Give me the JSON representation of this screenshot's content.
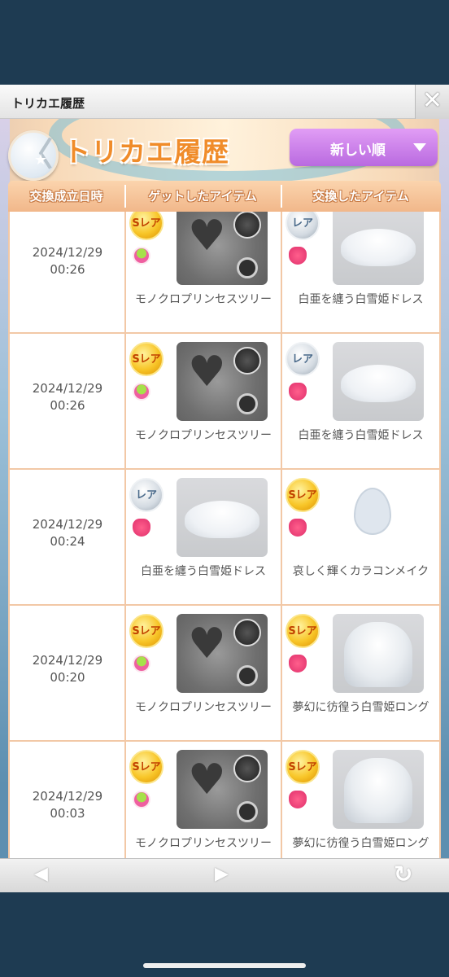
{
  "window": {
    "title": "トリカエ履歴",
    "close_glyph": "✕"
  },
  "header": {
    "back_glyph": "〈",
    "title": "トリカエ履歴",
    "sort_label": "新しい順"
  },
  "table": {
    "columns": [
      "交換成立日時",
      "ゲットしたアイテム",
      "交換したアイテム"
    ],
    "rows": [
      {
        "date": "2024/12/29",
        "time": "00:26",
        "get": {
          "rarity": "Sレア",
          "category": "face",
          "image": "heart-mirror",
          "name": "モノクロプリンセスツリー"
        },
        "gave": {
          "rarity": "レア",
          "category": "dress",
          "image": "white-dress",
          "name": "白亜を纏う白雪姫ドレス"
        }
      },
      {
        "date": "2024/12/29",
        "time": "00:26",
        "get": {
          "rarity": "Sレア",
          "category": "face",
          "image": "heart-mirror",
          "name": "モノクロプリンセスツリー"
        },
        "gave": {
          "rarity": "レア",
          "category": "dress",
          "image": "white-dress",
          "name": "白亜を纏う白雪姫ドレス"
        }
      },
      {
        "date": "2024/12/29",
        "time": "00:24",
        "get": {
          "rarity": "レア",
          "category": "dress",
          "image": "white-dress",
          "name": "白亜を纏う白雪姫ドレス"
        },
        "gave": {
          "rarity": "Sレア",
          "category": "dress",
          "image": "color-contact",
          "name": "哀しく輝くカラコンメイク"
        }
      },
      {
        "date": "2024/12/29",
        "time": "00:20",
        "get": {
          "rarity": "Sレア",
          "category": "face",
          "image": "heart-mirror",
          "name": "モノクロプリンセスツリー"
        },
        "gave": {
          "rarity": "Sレア",
          "category": "dress",
          "image": "white-hair",
          "name": "夢幻に彷徨う白雪姫ロング"
        }
      },
      {
        "date": "2024/12/29",
        "time": "00:03",
        "get": {
          "rarity": "Sレア",
          "category": "face",
          "image": "heart-mirror",
          "name": "モノクロプリンセスツリー"
        },
        "gave": {
          "rarity": "Sレア",
          "category": "dress",
          "image": "white-hair",
          "name": "夢幻に彷徨う白雪姫ロング"
        }
      }
    ]
  },
  "browser_nav": {
    "back_glyph": "◀",
    "forward_glyph": "▶",
    "reload_glyph": "↻"
  },
  "colors": {
    "accent_orange": "#f08c2a",
    "sort_purple": "#c77de8",
    "table_border": "#f2c8a6",
    "page_bg": "#1e3b52"
  }
}
